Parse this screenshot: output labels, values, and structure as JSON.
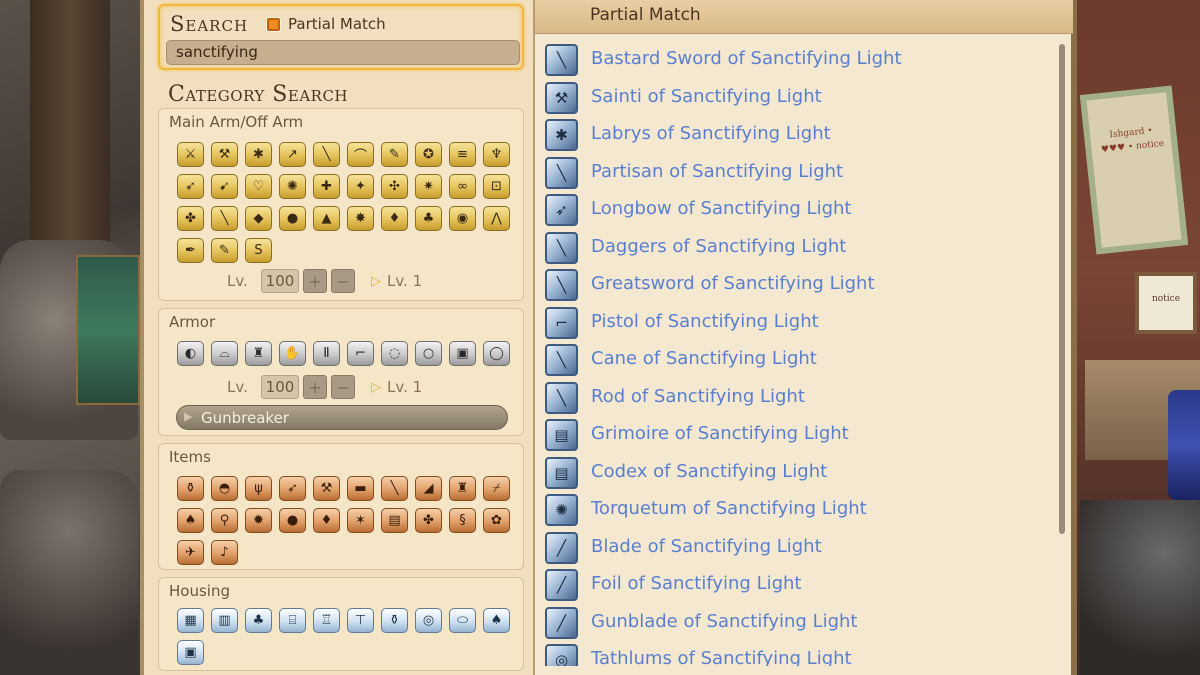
{
  "search": {
    "title": "Search",
    "partial_match_label": "Partial Match",
    "input_value": "sanctifying"
  },
  "category": {
    "title": "Category Search",
    "main_arm": {
      "title": "Main Arm/Off Arm",
      "lv_label": "Lv.",
      "lv_value": "100",
      "lv_to": "Lv. 1"
    },
    "armor": {
      "title": "Armor",
      "lv_label": "Lv.",
      "lv_value": "100",
      "lv_to": "Lv. 1",
      "job": "Gunbreaker"
    },
    "items": {
      "title": "Items"
    },
    "housing": {
      "title": "Housing"
    }
  },
  "results": {
    "header": "Partial Match",
    "items": [
      "Bastard Sword of Sanctifying Light",
      "Sainti of Sanctifying Light",
      "Labrys of Sanctifying Light",
      "Partisan of Sanctifying Light",
      "Longbow of Sanctifying Light",
      "Daggers of Sanctifying Light",
      "Greatsword of Sanctifying Light",
      "Pistol of Sanctifying Light",
      "Cane of Sanctifying Light",
      "Rod of Sanctifying Light",
      "Grimoire of Sanctifying Light",
      "Codex of Sanctifying Light",
      "Torquetum of Sanctifying Light",
      "Blade of Sanctifying Light",
      "Foil of Sanctifying Light",
      "Gunblade of Sanctifying Light",
      "Tathlums of Sanctifying Light"
    ]
  },
  "background": {
    "board_text": "Ishgard • ♥♥♥ • notice",
    "sign_text": "notice"
  },
  "colors": {
    "accent": "#f0b73a",
    "result_text": "#5a7fd0",
    "panel_bg": "#f1dfbf"
  }
}
